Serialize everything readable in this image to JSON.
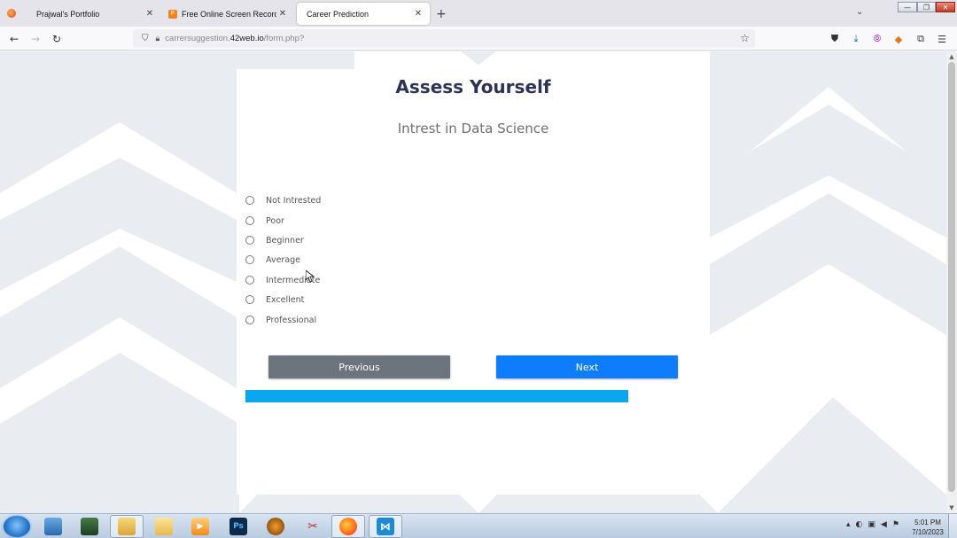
{
  "browser": {
    "tabs": [
      {
        "title": "Prajwal's Portfolio",
        "active": false
      },
      {
        "title": "Free Online Screen Recorder &",
        "active": false
      },
      {
        "title": "Career Prediction",
        "active": true
      }
    ],
    "url_prefix": "carrersuggestion.",
    "url_domain": "42web.io",
    "url_path": "/form.php?"
  },
  "page": {
    "heading": "Assess Yourself",
    "question": "Intrest in Data Science",
    "options": [
      "Not Intrested",
      "Poor",
      "Beginner",
      "Average",
      "Intermediate",
      "Excellent",
      "Professional"
    ],
    "previous_label": "Previous",
    "next_label": "Next",
    "progress_fraction": 1.0
  },
  "taskbar": {
    "time": "5:01 PM",
    "date": "7/10/2023"
  },
  "colors": {
    "heading": "#2d3354",
    "next_button": "#0d7dfd",
    "previous_button": "#6c757d",
    "progress": "#0aa6ee"
  }
}
